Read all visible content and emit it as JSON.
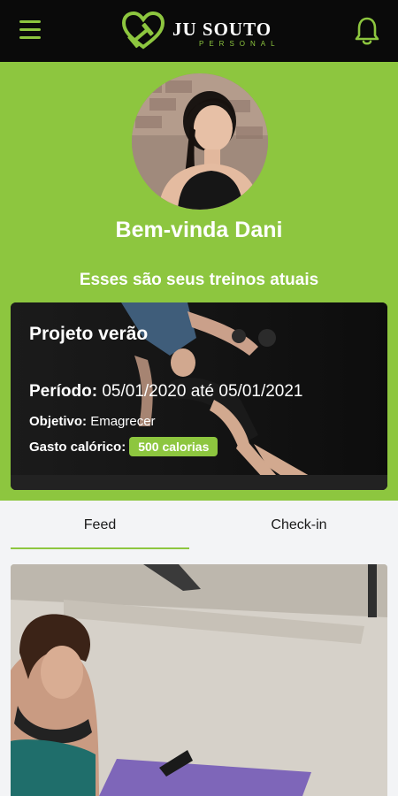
{
  "header": {
    "brand_name": "JU SOUTO",
    "brand_sub": "PERSONAL",
    "accent_color": "#8dc63f",
    "icons": {
      "menu": "hamburger-menu-icon",
      "logo": "heart-dumbbell-logo",
      "notifications": "bell-icon"
    }
  },
  "hero": {
    "welcome": "Bem-vinda Dani",
    "subtitle": "Esses são seus treinos atuais"
  },
  "workout": {
    "title": "Projeto verão",
    "period_label": "Período:",
    "period_value": "05/01/2020 até 05/01/2021",
    "goal_label": "Objetivo:",
    "goal_value": "Emagrecer",
    "calories_label": "Gasto calórico:",
    "calories_value": "500 calorias"
  },
  "tabs": [
    {
      "label": "Feed",
      "active": true
    },
    {
      "label": "Check-in",
      "active": false
    }
  ]
}
